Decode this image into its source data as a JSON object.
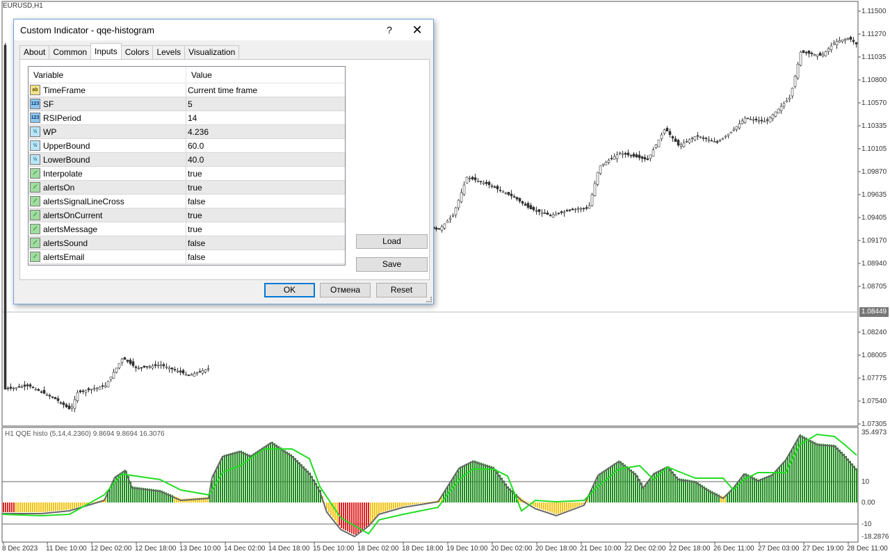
{
  "chart": {
    "symbol": "EURUSD,H1",
    "indicator_label": "H1 QQE histo (5,14,4.2360) 9.8694 9.8694 16.3076",
    "current_price": "1.08449",
    "price_axis": [
      "1.11500",
      "1.11270",
      "1.11035",
      "1.10800",
      "1.10570",
      "1.10335",
      "1.10105",
      "1.09870",
      "1.09635",
      "1.09405",
      "1.09170",
      "1.08940",
      "1.08705",
      "1.08240",
      "1.08005",
      "1.07775",
      "1.07540",
      "1.07305"
    ],
    "indicator_axis": [
      "35.4973",
      "10",
      "0.00",
      "-10",
      "-18.2876"
    ],
    "time_axis": [
      "8 Dec 2023",
      "11 Dec 10:00",
      "12 Dec 02:00",
      "12 Dec 18:00",
      "13 Dec 10:00",
      "14 Dec 02:00",
      "14 Dec 18:00",
      "15 Dec 10:00",
      "18 Dec 02:00",
      "18 Dec 18:00",
      "19 Dec 10:00",
      "20 Dec 02:00",
      "20 Dec 18:00",
      "21 Dec 10:00",
      "22 Dec 02:00",
      "22 Dec 18:00",
      "26 Dec 11:00",
      "27 Dec 03:00",
      "27 Dec 19:00",
      "28 Dec 11:00"
    ]
  },
  "dialog": {
    "title": "Custom Indicator - qqe-histogram",
    "help": "?",
    "close": "✕",
    "tabs": [
      "About",
      "Common",
      "Inputs",
      "Colors",
      "Levels",
      "Visualization"
    ],
    "active_tab": "Inputs",
    "grid": {
      "col_variable": "Variable",
      "col_value": "Value",
      "rows": [
        {
          "icon": "ab",
          "type": "str",
          "name": "TimeFrame",
          "value": "Current time frame"
        },
        {
          "icon": "123",
          "type": "int",
          "name": "SF",
          "value": "5"
        },
        {
          "icon": "123",
          "type": "int",
          "name": "RSIPeriod",
          "value": "14"
        },
        {
          "icon": "½",
          "type": "dbl",
          "name": "WP",
          "value": "4.236"
        },
        {
          "icon": "½",
          "type": "dbl",
          "name": "UpperBound",
          "value": "60.0"
        },
        {
          "icon": "½",
          "type": "dbl",
          "name": "LowerBound",
          "value": "40.0"
        },
        {
          "icon": "⟋",
          "type": "bool",
          "name": "Interpolate",
          "value": "true"
        },
        {
          "icon": "⟋",
          "type": "bool",
          "name": "alertsOn",
          "value": "true"
        },
        {
          "icon": "⟋",
          "type": "bool",
          "name": "alertsSignalLineCross",
          "value": "false"
        },
        {
          "icon": "⟋",
          "type": "bool",
          "name": "alertsOnCurrent",
          "value": "true"
        },
        {
          "icon": "⟋",
          "type": "bool",
          "name": "alertsMessage",
          "value": "true"
        },
        {
          "icon": "⟋",
          "type": "bool",
          "name": "alertsSound",
          "value": "false"
        },
        {
          "icon": "⟋",
          "type": "bool",
          "name": "alertsEmail",
          "value": "false"
        }
      ]
    },
    "load_label": "Load",
    "save_label": "Save",
    "ok_label": "OK",
    "cancel_label": "Отмена",
    "reset_label": "Reset"
  }
}
